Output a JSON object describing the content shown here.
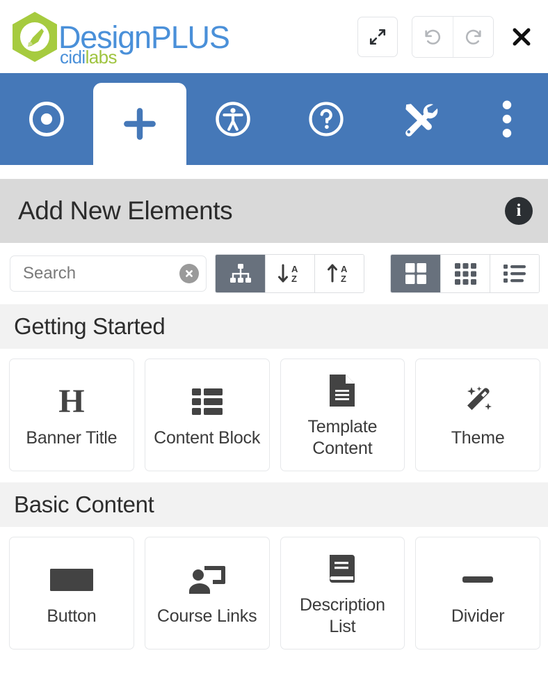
{
  "brand": {
    "title": "DesignPLUS",
    "sub_first": "cidi",
    "sub_second": "labs",
    "logo_icon": "paintbrush-hexagon-logo",
    "title_color": "#4a90d9",
    "accent_green": "#9fc440"
  },
  "window_controls": [
    {
      "name": "expand-button",
      "icon": "expand-arrows-icon"
    },
    {
      "name": "undo-button",
      "icon": "undo-arrow-icon"
    },
    {
      "name": "redo-button",
      "icon": "redo-arrow-icon"
    },
    {
      "name": "close-button",
      "icon": "close-x-icon"
    }
  ],
  "nav": {
    "bar_color": "#4578b8",
    "tabs": [
      {
        "name": "tab-target",
        "icon": "target-bullseye-icon",
        "active": false
      },
      {
        "name": "tab-add",
        "icon": "plus-icon",
        "active": true
      },
      {
        "name": "tab-accessibility",
        "icon": "accessibility-person-icon",
        "active": false
      },
      {
        "name": "tab-help",
        "icon": "question-circle-icon",
        "active": false
      },
      {
        "name": "tab-tools",
        "icon": "tools-wrench-screwdriver-icon",
        "active": false
      },
      {
        "name": "tab-more",
        "icon": "kebab-menu-icon",
        "active": false
      }
    ]
  },
  "header": {
    "title": "Add New Elements",
    "info_label": "i",
    "background": "#d9d9d9"
  },
  "toolbar": {
    "search": {
      "placeholder": "Search",
      "value": "",
      "clear_icon": "clear-circle-x-icon"
    },
    "sort_group": [
      {
        "name": "sort-hierarchy-button",
        "icon": "sitemap-icon",
        "active": true
      },
      {
        "name": "sort-asc-button",
        "icon": "sort-alpha-down-icon",
        "active": false
      },
      {
        "name": "sort-desc-button",
        "icon": "sort-alpha-up-icon",
        "active": false
      }
    ],
    "view_group": [
      {
        "name": "view-large-grid-button",
        "icon": "grid-2x2-icon",
        "active": true
      },
      {
        "name": "view-small-grid-button",
        "icon": "grid-3x3-icon",
        "active": false
      },
      {
        "name": "view-list-button",
        "icon": "list-icon",
        "active": false
      }
    ],
    "active_color": "#68717d"
  },
  "sections": [
    {
      "title": "Getting Started",
      "cards": [
        {
          "label": "Banner Title",
          "icon": "heading-h-icon"
        },
        {
          "label": "Content Block",
          "icon": "content-block-list-icon"
        },
        {
          "label": "Template Content",
          "icon": "document-file-icon"
        },
        {
          "label": "Theme",
          "icon": "magic-wand-icon"
        }
      ]
    },
    {
      "title": "Basic Content",
      "cards": [
        {
          "label": "Button",
          "icon": "button-rectangle-icon"
        },
        {
          "label": "Course Links",
          "icon": "course-links-person-screen-icon"
        },
        {
          "label": "Description List",
          "icon": "book-icon"
        },
        {
          "label": "Divider",
          "icon": "horizontal-rule-icon"
        }
      ]
    }
  ]
}
